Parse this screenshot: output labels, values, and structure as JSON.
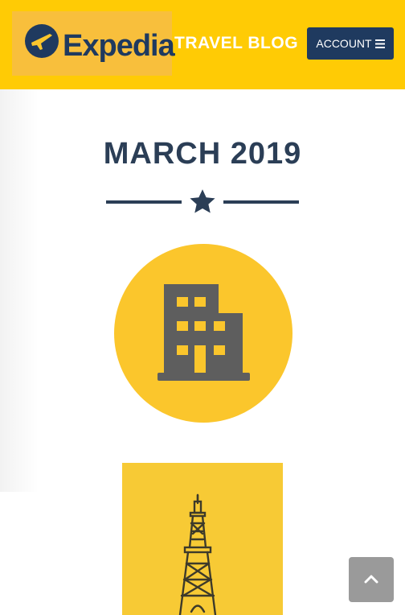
{
  "header": {
    "logo_text": "Expedia",
    "blog_title": "TRAVEL BLOG",
    "account_label": "ACCOUNT"
  },
  "main": {
    "month_title": "MARCH 2019"
  },
  "icons": {
    "menu": "hamburger-icon",
    "divider": "star-icon",
    "hotel": "building-icon",
    "image": "eiffel-tower-illustration",
    "back_to_top": "chevron-up-icon"
  },
  "colors": {
    "header_bg": "#ffcb05",
    "navy": "#1f3a5f",
    "title": "#2b3e56",
    "circle": "#fbc62c",
    "building": "#5e5e5e"
  }
}
